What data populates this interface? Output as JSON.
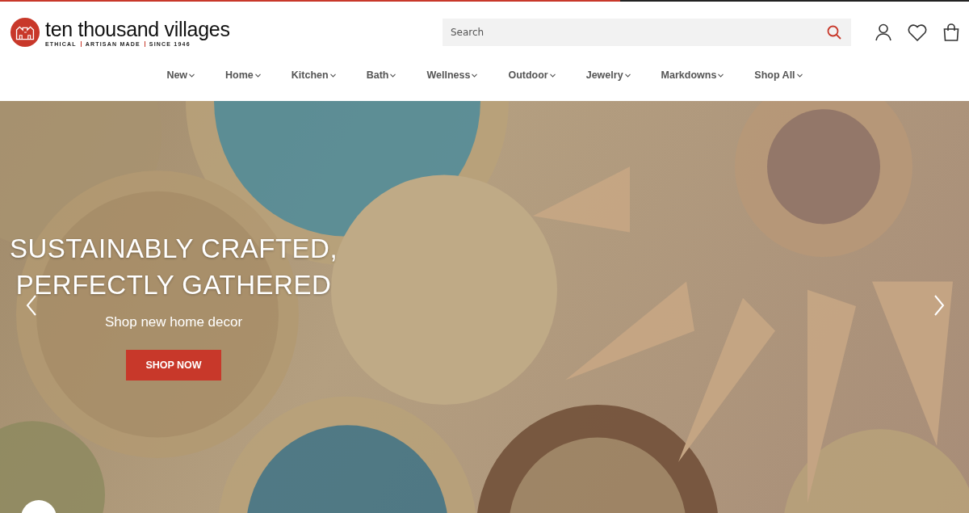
{
  "loading_bar": {
    "level": 0.64
  },
  "header": {
    "logo": {
      "name": "ten thousand villages",
      "tagline": [
        "ETHICAL",
        "ARTISAN MADE",
        "SINCE 1946"
      ]
    },
    "search": {
      "placeholder": "Search"
    }
  },
  "nav": [
    {
      "label": "New"
    },
    {
      "label": "Home"
    },
    {
      "label": "Kitchen"
    },
    {
      "label": "Bath"
    },
    {
      "label": "Wellness"
    },
    {
      "label": "Outdoor"
    },
    {
      "label": "Jewelry"
    },
    {
      "label": "Markdowns"
    },
    {
      "label": "Shop All"
    }
  ],
  "hero": {
    "headline": [
      "SUSTAINABLY CRAFTED,",
      "PERFECTLY GATHERED"
    ],
    "subtitle": "Shop new home decor",
    "button": "SHOP NOW"
  }
}
